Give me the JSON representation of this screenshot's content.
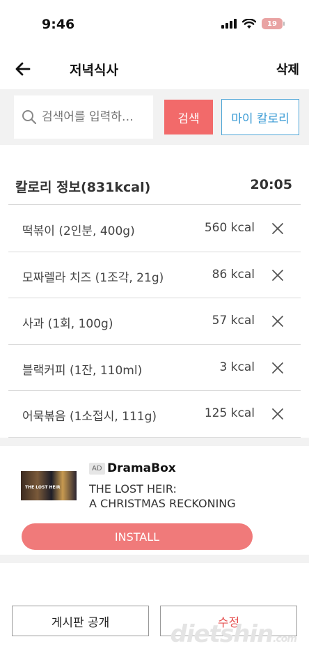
{
  "status_bar": {
    "time": "9:46",
    "battery": "19"
  },
  "header": {
    "title": "저녁식사",
    "delete_label": "삭제"
  },
  "search": {
    "placeholder": "검색어를 입력하…",
    "search_label": "검색",
    "my_calorie_label": "마이 칼로리"
  },
  "calorie_info": {
    "title": "칼로리 정보(831kcal)",
    "time": "20:05"
  },
  "foods": [
    {
      "name": "떡볶이 (2인분, 400g)",
      "kcal": "560 kcal"
    },
    {
      "name": "모짜렐라 치즈 (1조각, 21g)",
      "kcal": "86 kcal"
    },
    {
      "name": "사과 (1회, 100g)",
      "kcal": "57 kcal"
    },
    {
      "name": "블랙커피 (1잔, 110ml)",
      "kcal": "3 kcal"
    },
    {
      "name": "어묵볶음 (1소접시, 111g)",
      "kcal": "125 kcal"
    }
  ],
  "ad": {
    "badge": "AD",
    "brand": "DramaBox",
    "headline_line1": "THE LOST HEIR:",
    "headline_line2": "A CHRISTMAS RECKONING",
    "thumb_text": "THE LOST HEIR",
    "install_label": "INSTALL"
  },
  "bottom": {
    "public_label": "게시판 공개",
    "edit_label": "수정"
  },
  "watermark": {
    "text": "dietshin",
    "suffix": ".com"
  },
  "colors": {
    "accent_red": "#f26a6a",
    "accent_blue": "#3a9bd5",
    "band_gray": "#f2f2f2"
  }
}
